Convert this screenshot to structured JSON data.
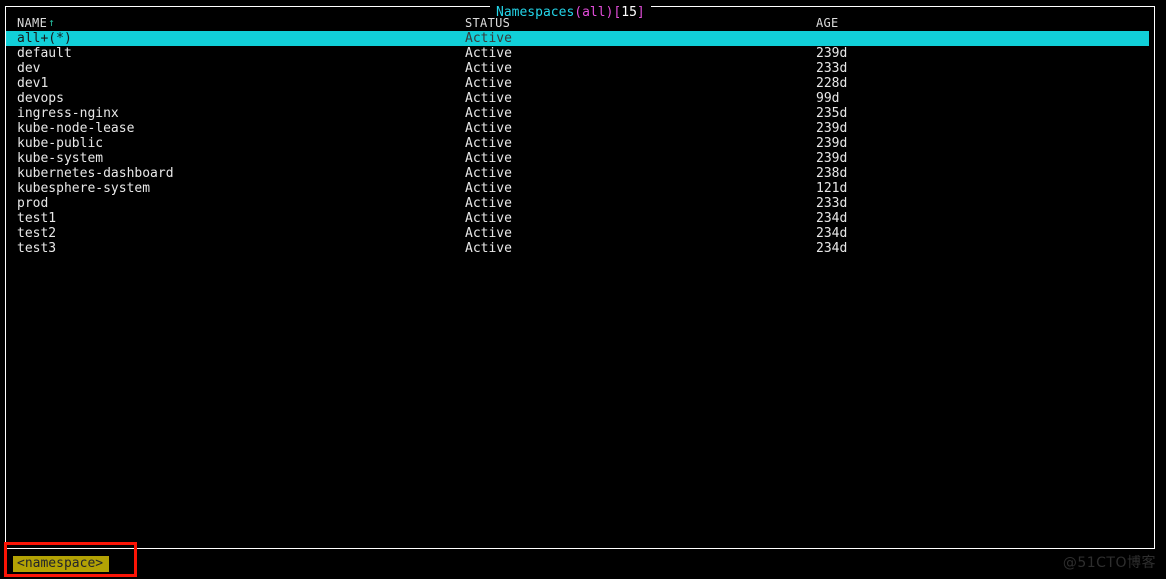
{
  "panel": {
    "title": {
      "resource": "Namespaces",
      "open_paren": "(",
      "scope": "all",
      "close_paren": ")",
      "open_bracket": "[",
      "count": "15",
      "close_bracket": "]"
    },
    "border_color": "#ffffff",
    "background_color": "#000000"
  },
  "table": {
    "columns": [
      {
        "key": "name",
        "label": "NAME",
        "sorted": true,
        "sort_arrow": "↑"
      },
      {
        "key": "status",
        "label": "STATUS",
        "sorted": false,
        "sort_arrow": ""
      },
      {
        "key": "age",
        "label": "AGE",
        "sorted": false,
        "sort_arrow": ""
      }
    ],
    "selected_index": 0,
    "selection_background": "#11cfd8",
    "rows": [
      {
        "name": "all+(*)",
        "status": "Active",
        "age": ""
      },
      {
        "name": "default",
        "status": "Active",
        "age": "239d"
      },
      {
        "name": "dev",
        "status": "Active",
        "age": "233d"
      },
      {
        "name": "dev1",
        "status": "Active",
        "age": "228d"
      },
      {
        "name": "devops",
        "status": "Active",
        "age": "99d"
      },
      {
        "name": "ingress-nginx",
        "status": "Active",
        "age": "235d"
      },
      {
        "name": "kube-node-lease",
        "status": "Active",
        "age": "239d"
      },
      {
        "name": "kube-public",
        "status": "Active",
        "age": "239d"
      },
      {
        "name": "kube-system",
        "status": "Active",
        "age": "239d"
      },
      {
        "name": "kubernetes-dashboard",
        "status": "Active",
        "age": "238d"
      },
      {
        "name": "kubesphere-system",
        "status": "Active",
        "age": "121d"
      },
      {
        "name": "prod",
        "status": "Active",
        "age": "233d"
      },
      {
        "name": "test1",
        "status": "Active",
        "age": "234d"
      },
      {
        "name": "test2",
        "status": "Active",
        "age": "234d"
      },
      {
        "name": "test3",
        "status": "Active",
        "age": "234d"
      }
    ]
  },
  "prompt": {
    "value": "<namespace>",
    "placeholder": "<namespace>",
    "background_color": "#b3a204",
    "text_color": "#22242b"
  },
  "annotation": {
    "color": "#fb1405",
    "shape": "rectangle"
  },
  "watermark": {
    "text": "@51CTO博客"
  }
}
